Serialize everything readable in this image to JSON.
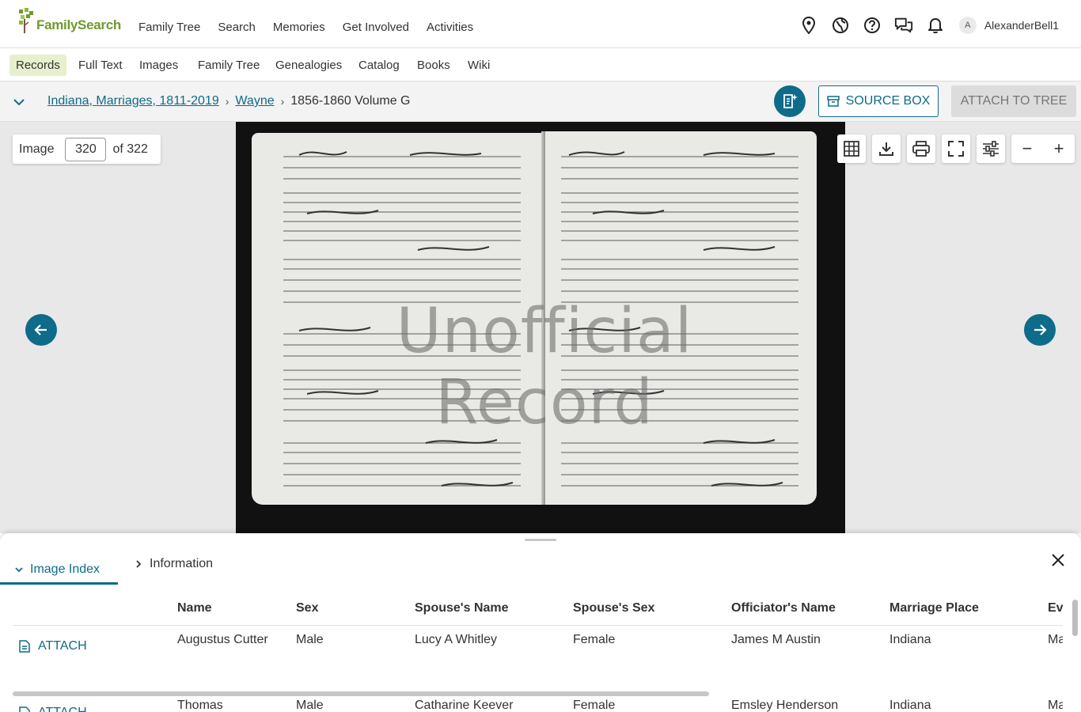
{
  "brand": {
    "name": "FamilySearch",
    "color": "#6f9a2e"
  },
  "main_menu": [
    "Family Tree",
    "Search",
    "Memories",
    "Get Involved",
    "Activities"
  ],
  "right_nav": {
    "icons": [
      "location-pin-icon",
      "globe-icon",
      "help-icon",
      "chat-icon",
      "bell-icon"
    ],
    "avatar_initial": "A",
    "username": "AlexanderBell1"
  },
  "sub_nav": {
    "items": [
      "Records",
      "Full Text",
      "Images",
      "Family Tree",
      "Genealogies",
      "Catalog",
      "Books",
      "Wiki"
    ],
    "active": "Records"
  },
  "breadcrumb": {
    "links": [
      "Indiana, Marriages, 1811-2019",
      "Wayne"
    ],
    "current": "1856-1860 Volume G"
  },
  "actions": {
    "source_box": "SOURCE BOX",
    "attach_to_tree": "ATTACH TO TREE"
  },
  "viewer": {
    "image_label": "Image",
    "current_image": "320",
    "total_label": "of 322",
    "watermark": "Unofficial Record",
    "tools": [
      "grid-icon",
      "download-icon",
      "print-icon",
      "fullscreen-icon",
      "adjust-icon"
    ],
    "zoom_out": "−",
    "zoom_in": "+"
  },
  "panel": {
    "tab_active": "Image Index",
    "tab_inactive": "Information",
    "columns": [
      "Name",
      "Sex",
      "Spouse's Name",
      "Spouse's Sex",
      "Officiator's Name",
      "Marriage Place",
      "Eve"
    ],
    "attach_label": "ATTACH",
    "rows": [
      [
        "Augustus Cutter",
        "Male",
        "Lucy A Whitley",
        "Female",
        "James M Austin",
        "Indiana",
        "Ma"
      ],
      [
        "Thomas",
        "Male",
        "Catharine Keever",
        "Female",
        "Emsley Henderson",
        "Indiana",
        "Ma"
      ]
    ]
  },
  "colors": {
    "accent": "#0e6b8a",
    "active_tab_bg": "#e7f0cc"
  }
}
